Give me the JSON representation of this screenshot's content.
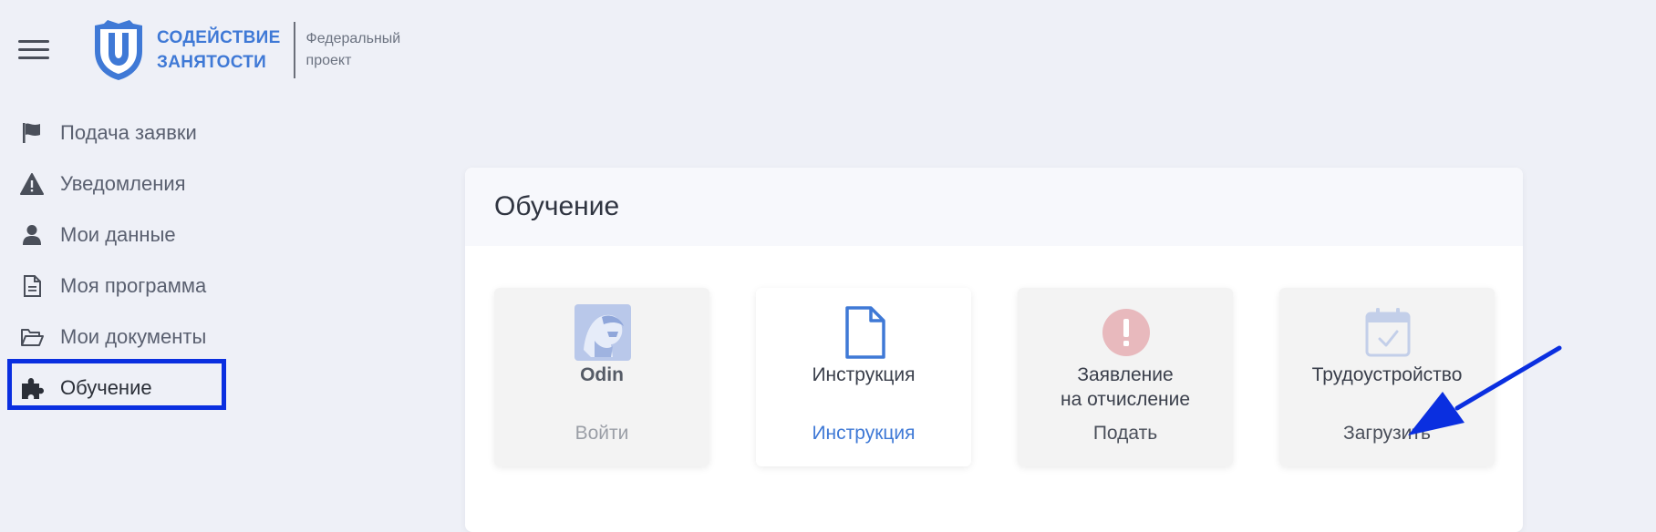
{
  "header": {
    "menu_icon": "hamburger-icon",
    "logo_line1": "СОДЕЙСТВИЕ",
    "logo_line2": "ЗАНЯТОСТИ",
    "logo_sub1": "Федеральный",
    "logo_sub2": "проект"
  },
  "sidebar": {
    "items": [
      {
        "label": "Подача заявки",
        "icon": "flag-icon"
      },
      {
        "label": "Уведомления",
        "icon": "warning-icon"
      },
      {
        "label": "Мои данные",
        "icon": "user-icon"
      },
      {
        "label": "Моя программа",
        "icon": "document-icon"
      },
      {
        "label": "Мои документы",
        "icon": "folder-open-icon"
      },
      {
        "label": "Обучение",
        "icon": "puzzle-icon",
        "active": true
      }
    ]
  },
  "main": {
    "title": "Обучение",
    "cards": [
      {
        "title": "Odin",
        "action": "Войти",
        "icon": "odin-logo-icon"
      },
      {
        "title": "Инструкция",
        "action": "Инструкция",
        "icon": "document-icon"
      },
      {
        "title_line1": "Заявление",
        "title_line2": "на отчисление",
        "action": "Подать",
        "icon": "exclamation-icon"
      },
      {
        "title": "Трудоустройство",
        "action": "Загрузить",
        "icon": "calendar-check-icon"
      }
    ]
  },
  "colors": {
    "accent": "#3f79d6",
    "highlight": "#0a2fe0",
    "link": "#3f79d6",
    "muted": "#9a9ea6"
  }
}
